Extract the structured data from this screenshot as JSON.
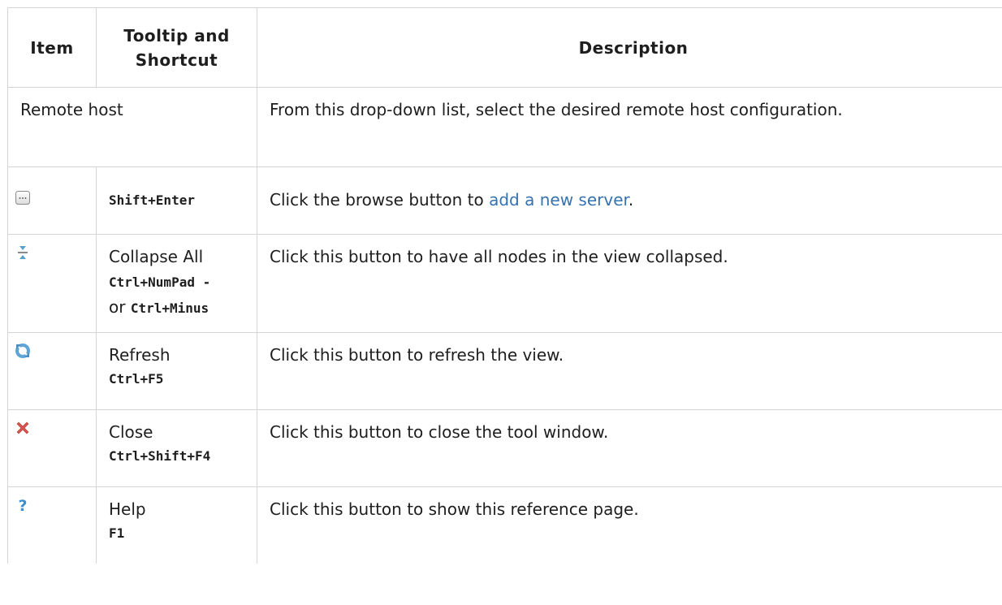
{
  "header": {
    "col_item": "Item",
    "col_tooltip": "Tooltip and Shortcut",
    "col_description": "Description"
  },
  "rows": {
    "remote_host": {
      "item": "Remote host",
      "description": "From this drop-down list, select the desired remote host configuration."
    },
    "browse": {
      "icon": "browse-ellipsis-icon",
      "shortcut": "Shift+Enter",
      "description_prefix": "Click the browse button to ",
      "description_link": "add a new server",
      "description_suffix": "."
    },
    "collapse": {
      "icon": "collapse-all-icon",
      "tooltip": "Collapse All",
      "shortcut_1": "Ctrl+NumPad -",
      "or_text": "or ",
      "shortcut_2": "Ctrl+Minus",
      "description": "Click this button to have all nodes in the view collapsed."
    },
    "refresh": {
      "icon": "refresh-icon",
      "tooltip": "Refresh",
      "shortcut": "Ctrl+F5",
      "description": "Click this button to refresh the view."
    },
    "close": {
      "icon": "close-icon",
      "tooltip": "Close",
      "shortcut": "Ctrl+Shift+F4",
      "description": "Click this button to close the tool window."
    },
    "help": {
      "icon": "help-icon",
      "tooltip": "Help",
      "shortcut": "F1",
      "description": "Click this button to show this reference page."
    }
  },
  "colors": {
    "link": "#3572b0",
    "border": "#d5d5d5",
    "text": "#1e1e1e"
  }
}
